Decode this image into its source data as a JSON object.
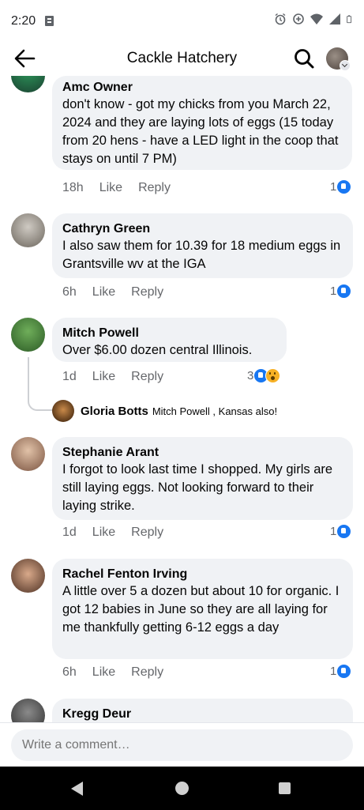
{
  "status": {
    "time": "2:20"
  },
  "header": {
    "title": "Cackle Hatchery"
  },
  "comments": [
    {
      "author": "Amc Owner",
      "text": "don't know - got my chicks from you March 22, 2024 and they are laying lots of eggs (15 today from 20 hens - have a LED light in the coop that stays on until 7 PM)",
      "time": "18h",
      "like": "Like",
      "reply": "Reply",
      "reactions": "1"
    },
    {
      "author": "Cathryn Green",
      "text": "I also saw them for 10.39 for 18 medium eggs in Grantsville wv at the IGA",
      "time": "6h",
      "like": "Like",
      "reply": "Reply",
      "reactions": "1"
    },
    {
      "author": "Mitch Powell",
      "text": "Over $6.00  dozen central Illinois.",
      "time": "1d",
      "like": "Like",
      "reply": "Reply",
      "reactions": "3"
    },
    {
      "author": "Stephanie Arant",
      "text": "I forgot to look last time I shopped. My girls are still laying eggs. Not looking forward to their laying strike.",
      "time": "1d",
      "like": "Like",
      "reply": "Reply",
      "reactions": "1"
    },
    {
      "author": "Rachel Fenton Irving",
      "text": "A little over 5 a dozen but about 10 for organic. I got 12 babies in June so they are all laying for me thankfully getting 6-12 eggs a day",
      "time": "6h",
      "like": "Like",
      "reply": "Reply",
      "reactions": "1"
    },
    {
      "author": "Kregg Deur"
    }
  ],
  "reply_preview": {
    "author": "Gloria Botts",
    "text": "Mitch Powell , Kansas also!"
  },
  "composer": {
    "placeholder": "Write a comment…"
  }
}
